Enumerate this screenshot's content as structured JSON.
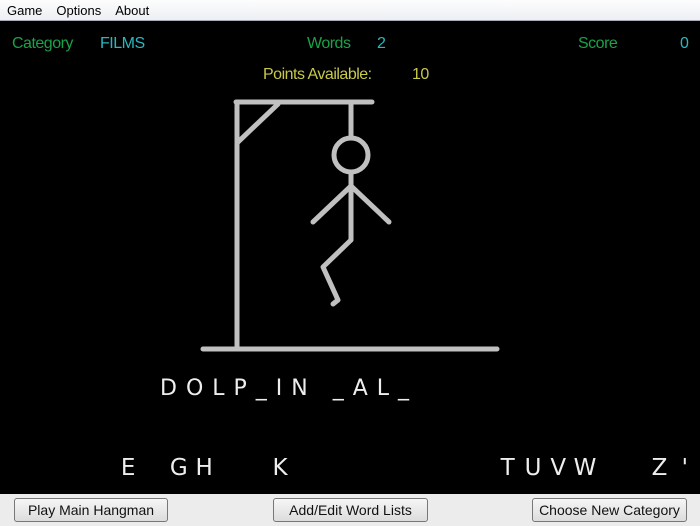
{
  "menu": [
    "Game",
    "Options",
    "About"
  ],
  "header": {
    "category_label": "Category",
    "category_value": "FILMS",
    "words_label": "Words",
    "words_value": "2",
    "score_label": "Score",
    "score_value": "0",
    "points_label": "Points Available:",
    "points_value": "10"
  },
  "word_display": "DOLP_IN _AL_",
  "letters": [
    "",
    "",
    "",
    "",
    "E",
    "",
    "G",
    "H",
    "",
    "",
    "K",
    "",
    "",
    "",
    "",
    "",
    "",
    "",
    "",
    "T",
    "U",
    "V",
    "W",
    "",
    "",
    "Z",
    "'"
  ],
  "buttons": {
    "play": "Play Main Hangman",
    "edit": "Add/Edit Word Lists",
    "category": "Choose New Category"
  },
  "colors": {
    "label": "#1aa24a",
    "value": "#2ab8c0",
    "points": "#c8c84a",
    "drawing": "#c0c0c0"
  }
}
